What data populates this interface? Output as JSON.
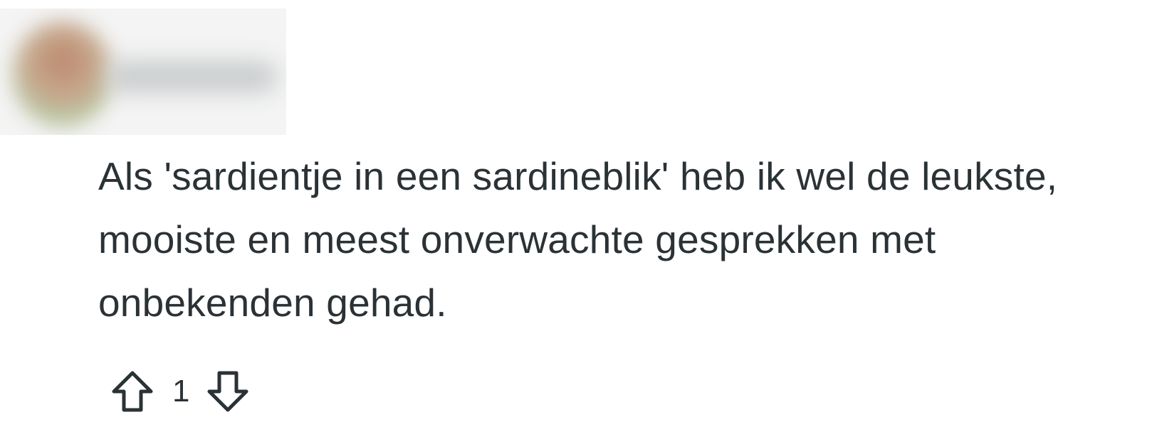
{
  "comment": {
    "author": {
      "name_blurred": true,
      "avatar_blurred": true
    },
    "body": "Als 'sardientje in een sardineblik' heb ik wel de leukste, mooiste en meest onverwachte gesprekken met onbekenden gehad.",
    "actions": {
      "upvote_icon": "arrow-up-outline-icon",
      "vote_count": "1",
      "downvote_icon": "arrow-down-outline-icon"
    }
  },
  "colors": {
    "text": "#2b3236",
    "background": "#ffffff",
    "author_block_bg": "#f4f4f4"
  }
}
